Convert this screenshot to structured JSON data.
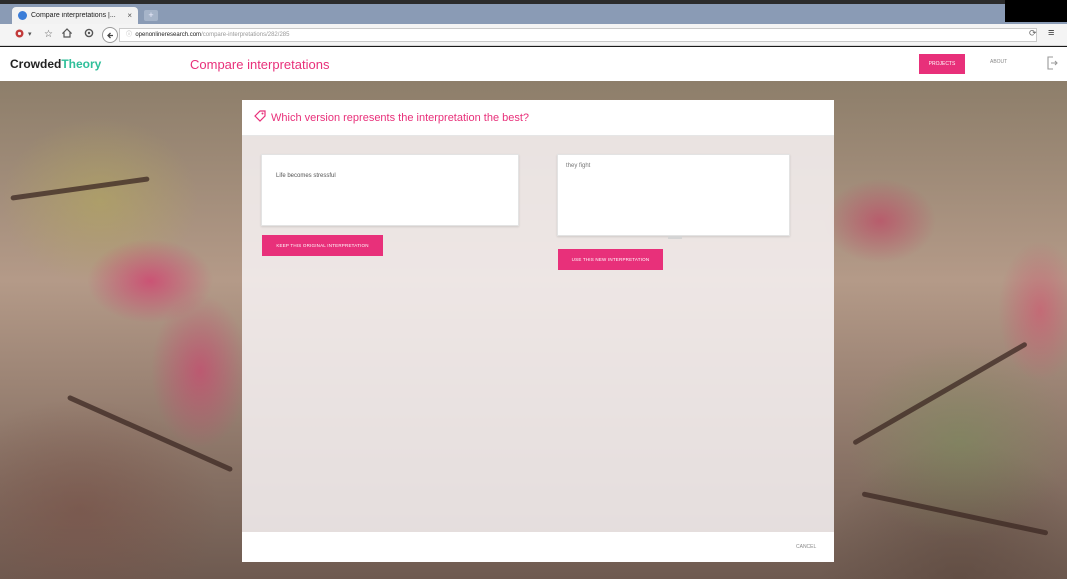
{
  "browser": {
    "tab_title": "Compare interpretations |...",
    "tab_close": "×",
    "new_tab": "+",
    "url_host": "openonlineresearch.com",
    "url_path": "/compare-interpretations/282/285",
    "nav_icons": [
      "settings-icon",
      "star-icon",
      "home-icon",
      "sync-icon",
      "back-icon",
      "reload-icon",
      "menu-icon"
    ]
  },
  "app": {
    "brand_part1": "Crowded",
    "brand_part2": "Theory",
    "page_title": "Compare interpretations",
    "nav": {
      "projects": "PROJECTS",
      "about": "ABOUT"
    },
    "colors": {
      "accent": "#e8307a",
      "brand_green": "#2fbf9a"
    }
  },
  "dialog": {
    "question": "Which version represents the interpretation the best?",
    "original_text": "Life becomes stressful",
    "new_text": "they fight",
    "keep_label": "KEEP THIS ORIGINAL INTERPRETATION",
    "use_label": "USE THIS NEW INTERPRETATION",
    "cancel_label": "CANCEL"
  }
}
